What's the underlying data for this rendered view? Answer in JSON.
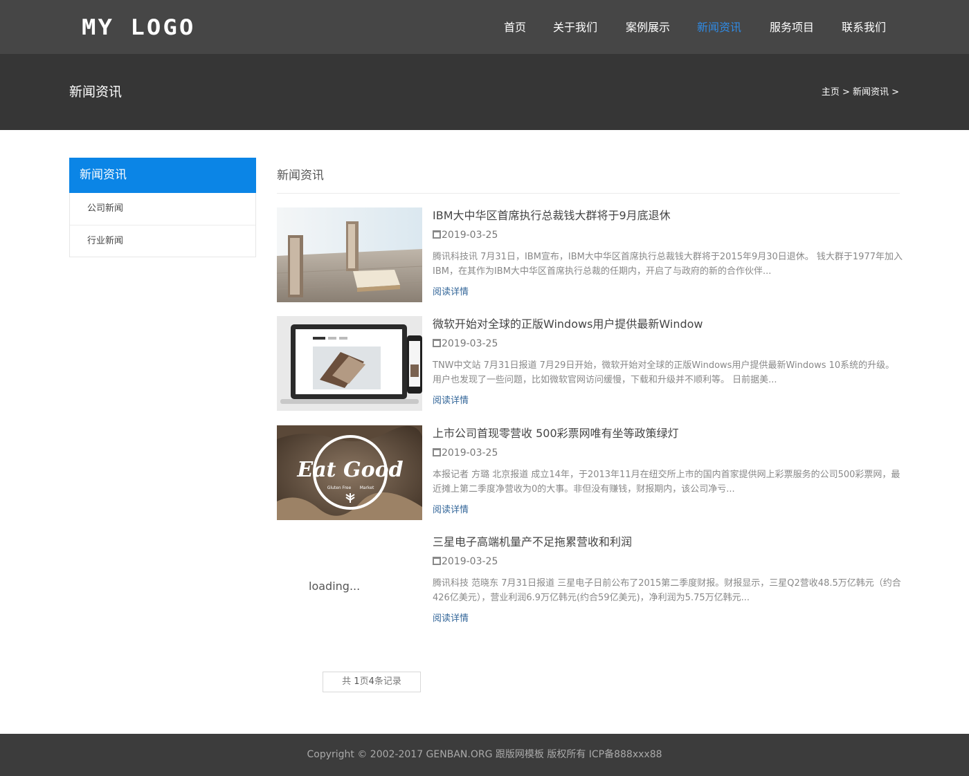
{
  "header": {
    "logo_text": "MY LOGO",
    "nav": [
      {
        "label": "首页"
      },
      {
        "label": "关于我们"
      },
      {
        "label": "案例展示"
      },
      {
        "label": "新闻资讯",
        "active": true
      },
      {
        "label": "服务项目"
      },
      {
        "label": "联系我们"
      }
    ]
  },
  "banner": {
    "title": "新闻资讯",
    "breadcrumb": "主页 > 新闻资讯 >"
  },
  "sidebar": {
    "title": "新闻资讯",
    "items": [
      {
        "label": "公司新闻"
      },
      {
        "label": "行业新闻"
      }
    ]
  },
  "main": {
    "title": "新闻资讯",
    "news": [
      {
        "title": "IBM大中华区首席执行总裁钱大群将于9月底退休",
        "date": "2019-03-25",
        "desc": "腾讯科技讯 7月31日，IBM宣布，IBM大中华区首席执行总裁钱大群将于2015年9月30日退休。 钱大群于1977年加入IBM，在其作为IBM大中华区首席执行总裁的任期内，开启了与政府的新的合作伙伴...",
        "more": "阅读详情",
        "thumb": "books-desk"
      },
      {
        "title": "微软开始对全球的正版Windows用户提供最新Window",
        "date": "2019-03-25",
        "desc": "TNW中文站 7月31日报道 7月29日开始，微软开始对全球的正版Windows用户提供最新Windows 10系统的升级。用户也发现了一些问题，比如微软官网访问缓慢，下载和升级并不顺利等。 日前据美...",
        "more": "阅读详情",
        "thumb": "laptop-phone"
      },
      {
        "title": "上市公司首现零营收 500彩票网唯有坐等政策绿灯",
        "date": "2019-03-25",
        "desc": "本报记者 方璐 北京报道 成立14年，于2013年11月在纽交所上市的国内首家提供网上彩票服务的公司500彩票网，最近摊上第二季度净营收为0的大事。非但没有赚钱，财报期内，该公司净亏...",
        "more": "阅读详情",
        "thumb": "eat-good",
        "thumb_text": "Eat Good",
        "thumb_small1": "Gluten Free",
        "thumb_small2": "Market"
      },
      {
        "title": "三星电子高端机量产不足拖累营收和利润",
        "date": "2019-03-25",
        "desc": "腾讯科技 范晓东 7月31日报道 三星电子日前公布了2015第二季度财报。财报显示，三星Q2营收48.5万亿韩元（约合426亿美元），营业利润6.9万亿韩元(约合59亿美元)，净利润为5.75万亿韩元...",
        "more": "阅读详情",
        "thumb": "loading",
        "thumb_text": "loading..."
      }
    ],
    "pager": {
      "prefix": "共",
      "pages": "1",
      "mid": "页",
      "records": "4",
      "suffix": "条记录"
    }
  },
  "footer": {
    "copyright": "Copyright © 2002-2017 GENBAN.ORG 跟版网模板 版权所有  ICP备888xxx88"
  },
  "colors": {
    "accent": "#0b85e6",
    "nav_active": "#2f8be6",
    "header_bg": "#464646",
    "banner_bg": "#363636",
    "footer_bg": "#3c3c3c"
  }
}
